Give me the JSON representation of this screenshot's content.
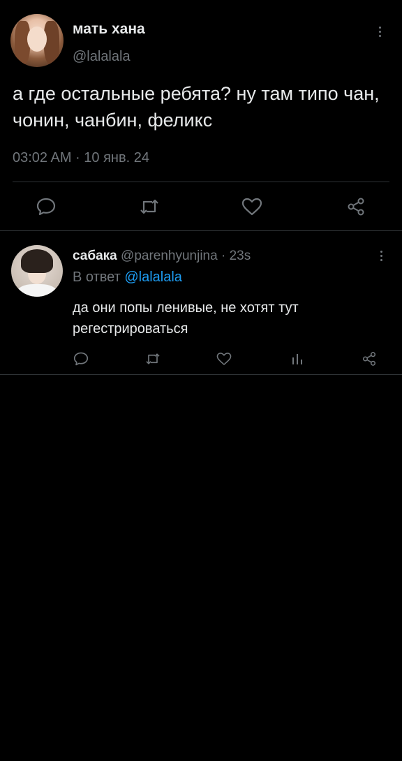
{
  "main_tweet": {
    "author_name": "мать хана",
    "author_handle": "@lalalala",
    "text": "а где остальные ребята? ну там типо чан, чонин, чанбин, феликс",
    "timestamp": "03:02 AM · 10 янв. 24",
    "actions": [
      "reply-icon",
      "retweet-icon",
      "like-icon",
      "share-icon"
    ]
  },
  "reply_tweet": {
    "author_name": "сабака",
    "author_handle": "@parenhyunjina",
    "separator": "·",
    "time": "23s",
    "reply_prefix": "В ответ",
    "reply_mention": "@lalalala",
    "text": "да они попы ленивые, не хотят тут регестрироваться",
    "actions": [
      "reply-icon",
      "retweet-icon",
      "like-icon",
      "views-icon",
      "share-icon"
    ]
  },
  "colors": {
    "background": "#000000",
    "primary_text": "#e7e9ea",
    "secondary_text": "#71767b",
    "accent": "#1d9bf0",
    "divider": "#2f3336"
  }
}
